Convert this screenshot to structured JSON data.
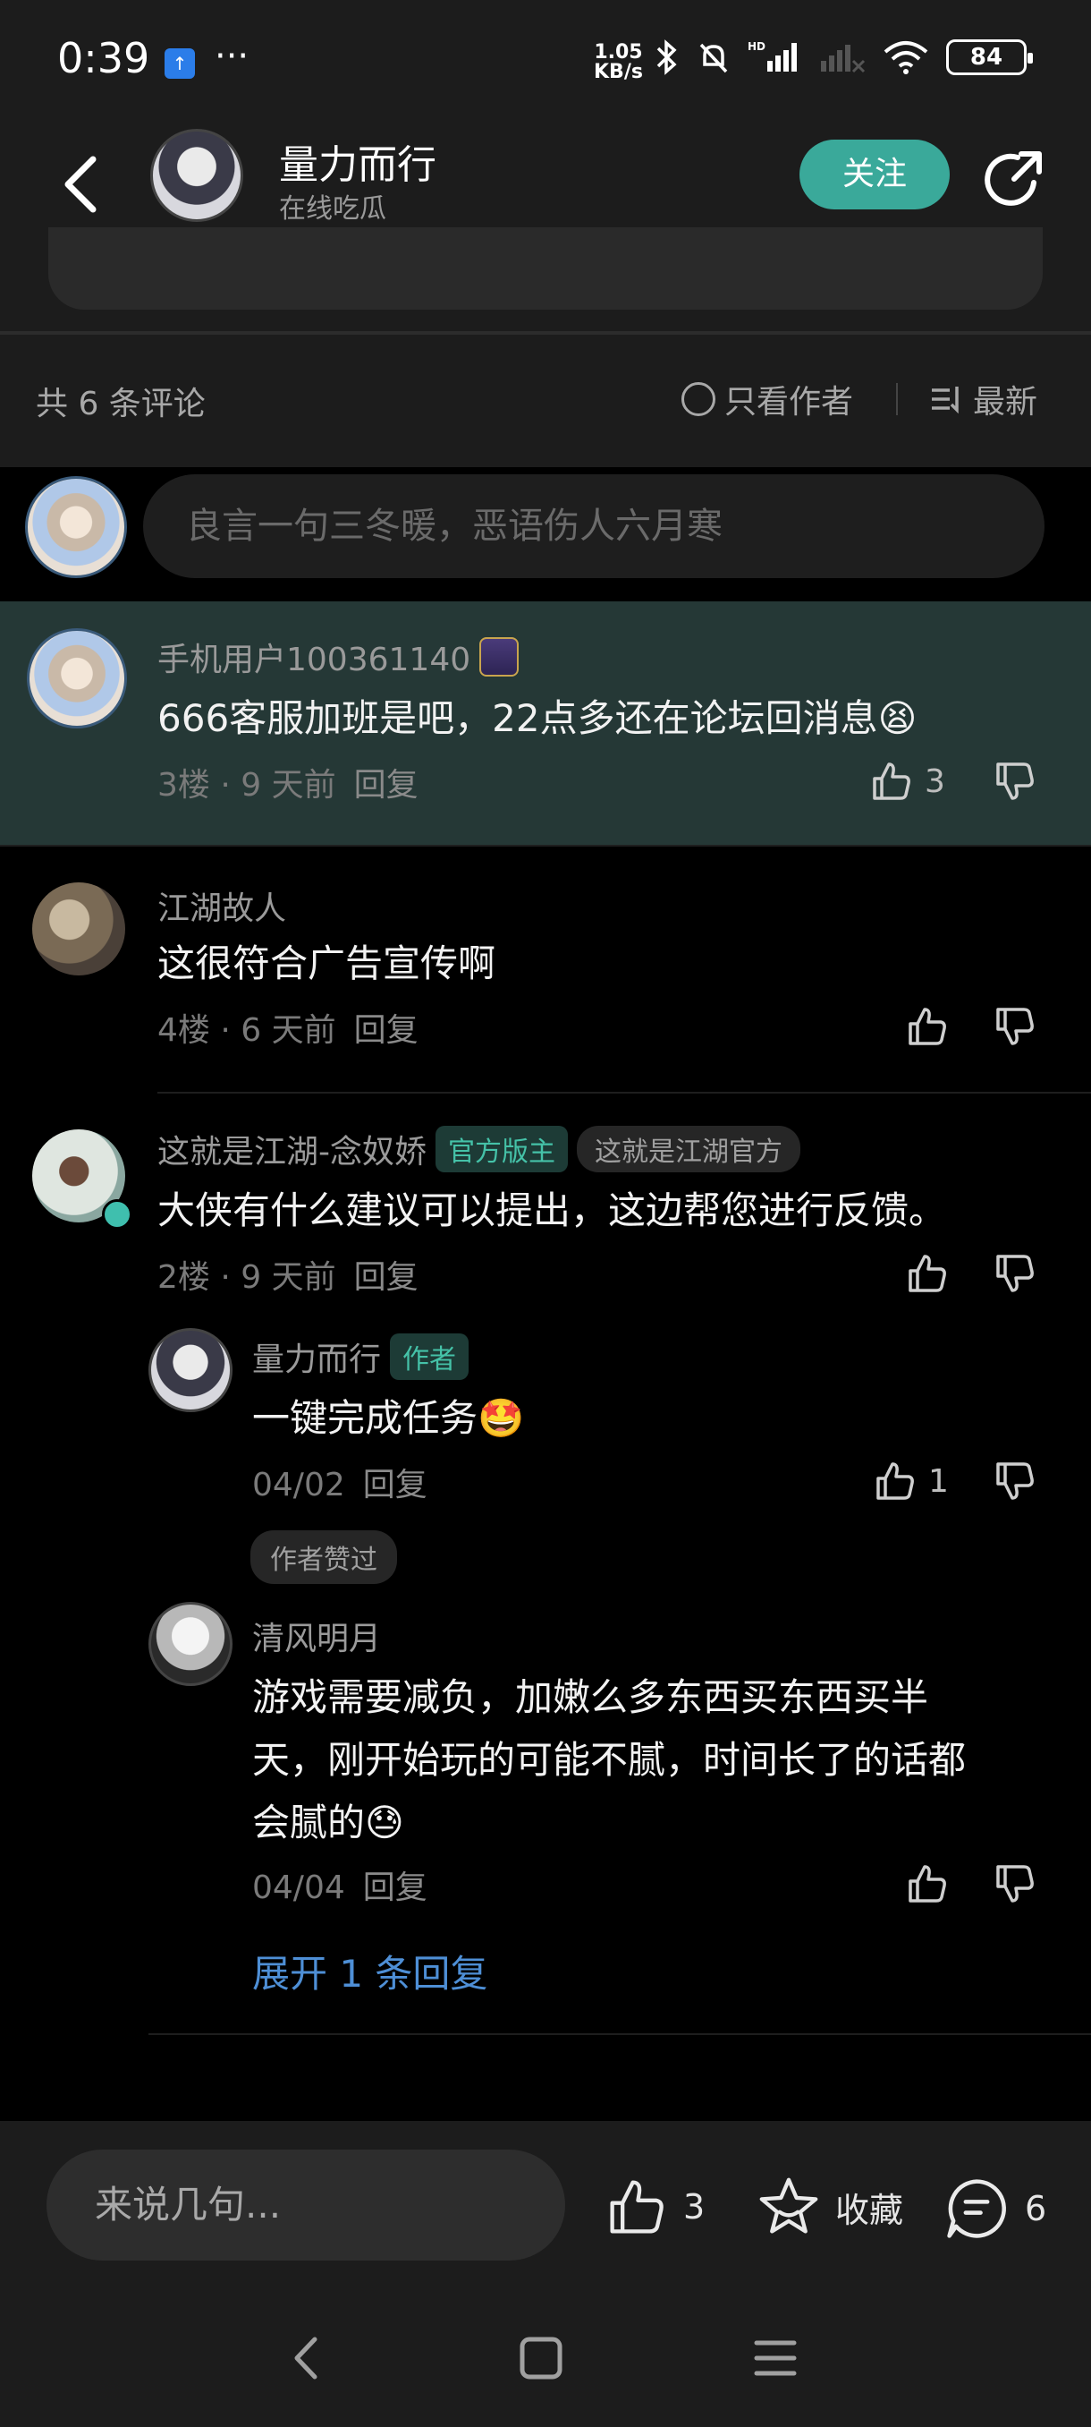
{
  "status": {
    "time": "0:39",
    "app_icon": "↑",
    "dots": "···",
    "speed_top": "1.05",
    "speed_bottom": "KB/s",
    "network_label": "HD",
    "battery": "84"
  },
  "header": {
    "name": "量力而行",
    "subtitle": "在线吃瓜",
    "follow_label": "关注"
  },
  "comments_bar": {
    "count_label": "共 6 条评论",
    "only_author_label": "只看作者",
    "sort_label": "最新"
  },
  "input": {
    "placeholder": "良言一句三冬暖，恶语伤人六月寒"
  },
  "comments": [
    {
      "user": "手机用户100361140",
      "text": "666客服加班是吧，22点多还在论坛回消息😫",
      "floor": "3楼",
      "time": "9 天前",
      "reply_label": "回复",
      "likes": "3"
    },
    {
      "user": "江湖故人",
      "text": "这很符合广告宣传啊",
      "floor": "4楼",
      "time": "6 天前",
      "reply_label": "回复"
    },
    {
      "user": "这就是江湖-念奴娇",
      "tag1": "官方版主",
      "tag2": "这就是江湖官方",
      "text": "大侠有什么建议可以提出，这边帮您进行反馈。",
      "floor": "2楼",
      "time": "9 天前",
      "reply_label": "回复"
    }
  ],
  "replies": [
    {
      "user": "量力而行",
      "tag": "作者",
      "text": "一键完成任务🤩",
      "time": "04/02",
      "reply_label": "回复",
      "likes": "1",
      "liked_badge": "作者赞过"
    },
    {
      "user": "清风明月",
      "text_line1": "游戏需要减负，加嫩么多东西买东西买半",
      "text_line2": "天，刚开始玩的可能不腻，时间长了的话都",
      "text_line3": "会腻的😓",
      "time": "04/04",
      "reply_label": "回复"
    }
  ],
  "expand_label": "展开 1 条回复",
  "bottom_bar": {
    "placeholder": "来说几句...",
    "likes": "3",
    "favorite_label": "收藏",
    "comments": "6"
  }
}
